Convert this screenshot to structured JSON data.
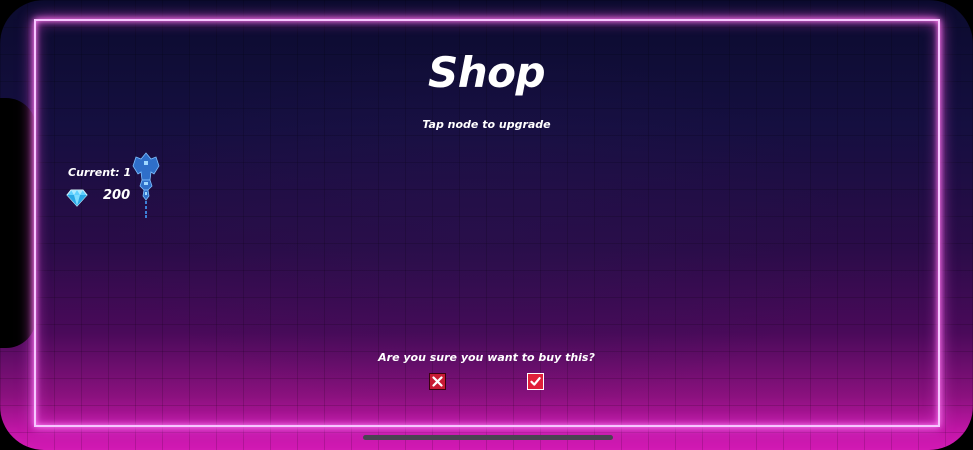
{
  "shop": {
    "title": "Shop",
    "subtitle": "Tap node to upgrade"
  },
  "status": {
    "current_label": "Current: 1",
    "gems": "200"
  },
  "dialog": {
    "question": "Are you sure you want to buy this?"
  },
  "icons": {
    "gem": "diamond-icon",
    "ship": "ship-icon",
    "cancel": "close-icon",
    "confirm": "checkmark-icon"
  },
  "colors": {
    "neon_frame": "#f6c6ff",
    "button_red": "#e0203a",
    "background_top": "#0b0b2e",
    "background_bottom": "#d21ab4"
  }
}
